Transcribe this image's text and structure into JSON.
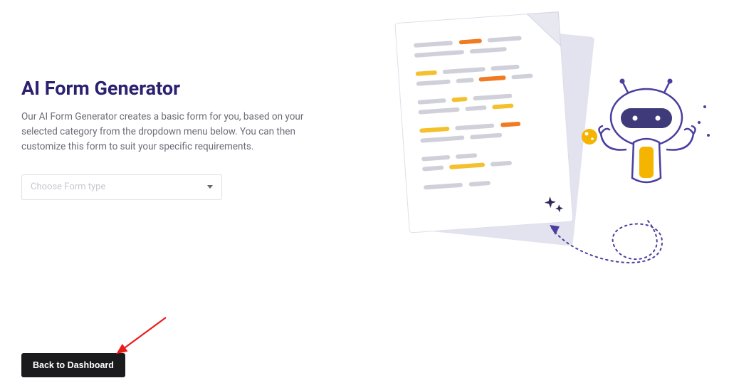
{
  "page": {
    "title": "AI Form Generator",
    "description": "Our AI Form Generator creates a basic form for you, based on your selected category from the dropdown menu below. You can then customize this form to suit your specific requirements."
  },
  "form_select": {
    "placeholder": "Choose Form type"
  },
  "buttons": {
    "back_to_dashboard": "Back to Dashboard"
  },
  "colors": {
    "title": "#2b2170",
    "text": "#6c6b78",
    "placeholder": "#c8c7d0",
    "button_bg": "#1b1b1e",
    "accent_orange": "#f6a623",
    "accent_dark_orange": "#ee7a1e",
    "accent_purple": "#5941c6",
    "paper_base": "#f6f6fb",
    "paper_line": "#c7c7d5",
    "paper_line_yellow": "#f4c02c",
    "paper_line_orange": "#f07b22",
    "annotation_arrow": "#eb1b1b"
  },
  "illustration": {
    "semantic": "robot-and-document-illustration"
  }
}
